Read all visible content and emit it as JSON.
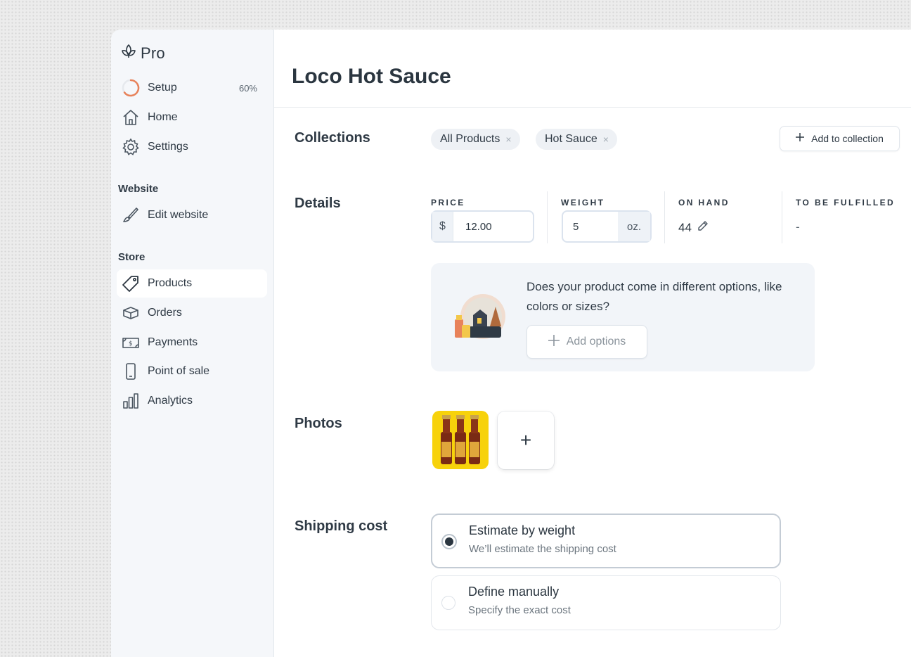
{
  "app": {
    "brand": "Pro"
  },
  "sidebar": {
    "setup": {
      "label": "Setup",
      "progress": "60%"
    },
    "items_top": [
      {
        "label": "Home",
        "icon": "home-icon"
      },
      {
        "label": "Settings",
        "icon": "gear-icon"
      }
    ],
    "website_section": "Website",
    "edit_website": "Edit website",
    "store_section": "Store",
    "store_items": [
      {
        "label": "Products",
        "icon": "tag-icon",
        "active": true
      },
      {
        "label": "Orders",
        "icon": "box-icon"
      },
      {
        "label": "Payments",
        "icon": "money-icon"
      },
      {
        "label": "Point of sale",
        "icon": "phone-icon"
      },
      {
        "label": "Analytics",
        "icon": "bar-chart-icon"
      }
    ]
  },
  "main": {
    "title": "Loco Hot Sauce",
    "collections": {
      "label": "Collections",
      "chips": [
        "All Products",
        "Hot Sauce"
      ],
      "chip_remove": "×",
      "add_button": "Add to collection"
    },
    "details": {
      "label": "Details",
      "price": {
        "caption": "PRICE",
        "prefix": "$",
        "value": "12.00"
      },
      "weight": {
        "caption": "WEIGHT",
        "value": "5",
        "unit": "oz."
      },
      "on_hand": {
        "caption": "ON HAND",
        "value": "44"
      },
      "to_be_fulfilled": {
        "caption": "TO BE FULFILLED",
        "value": "-"
      },
      "options_prompt": "Does your product come in different options, like colors or sizes?",
      "add_options": "Add options"
    },
    "photos": {
      "label": "Photos",
      "add": "+"
    },
    "shipping": {
      "label": "Shipping cost",
      "options": [
        {
          "title": "Estimate by weight",
          "subtitle": "We’ll estimate the shipping cost",
          "selected": true
        },
        {
          "title": "Define manually",
          "subtitle": "Specify the exact cost",
          "selected": false
        }
      ]
    }
  },
  "colors": {
    "accent": "#e8825a",
    "photo_bg": "#f7d20b",
    "text": "#2b3640"
  }
}
